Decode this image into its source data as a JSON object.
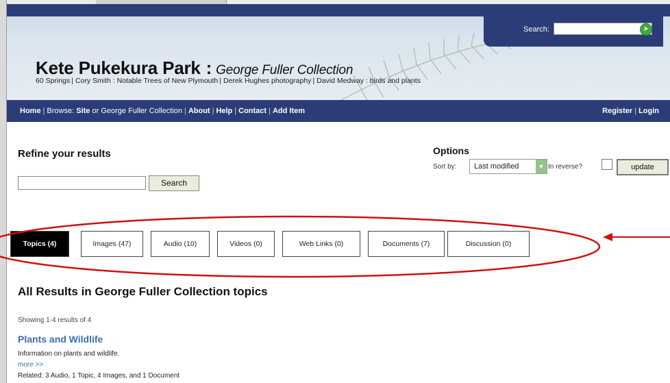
{
  "header": {
    "search_label": "Search:",
    "site_title": "Kete Pukekura Park",
    "title_separator": ":",
    "collection_title": "George Fuller Collection",
    "sublinks": [
      "60 Springs",
      "Cory Smith : Notable Trees of New Plymouth",
      "Derek Hughes photography",
      "David Medway : birds and plants"
    ]
  },
  "nav": {
    "home": "Home",
    "browse": "Browse:",
    "site": "Site",
    "or": "or",
    "collection": "George Fuller Collection",
    "about": "About",
    "help": "Help",
    "contact": "Contact",
    "add_item": "Add Item",
    "register": "Register",
    "login": "Login"
  },
  "refine": {
    "title": "Refine your results",
    "search_value": "",
    "search_button": "Search"
  },
  "options": {
    "title": "Options",
    "sort_by_label": "Sort by:",
    "sort_selected": "Last modified",
    "reverse_label": "In reverse?",
    "reverse_checked": false,
    "update_button": "update"
  },
  "tabs": [
    {
      "label": "Topics (4)",
      "active": true
    },
    {
      "label": "Images (47)",
      "active": false
    },
    {
      "label": "Audio (10)",
      "active": false
    },
    {
      "label": "Videos (0)",
      "active": false
    },
    {
      "label": "Web Links (0)",
      "active": false
    },
    {
      "label": "Documents (7)",
      "active": false
    },
    {
      "label": "Discussion (0)",
      "active": false
    }
  ],
  "results": {
    "title": "All Results in George Fuller Collection topics",
    "showing": "Showing 1-4 results of 4",
    "items": [
      {
        "title": "Plants and Wildlife",
        "description": "Information on plants and wildlife.",
        "more": "more >>",
        "related": "Related: 3 Audio, 1 Topic, 4 Images, and 1 Document"
      }
    ]
  },
  "colors": {
    "navy": "#2b3c76",
    "link_blue": "#3a6fae",
    "annotation_red": "#cc1111"
  }
}
